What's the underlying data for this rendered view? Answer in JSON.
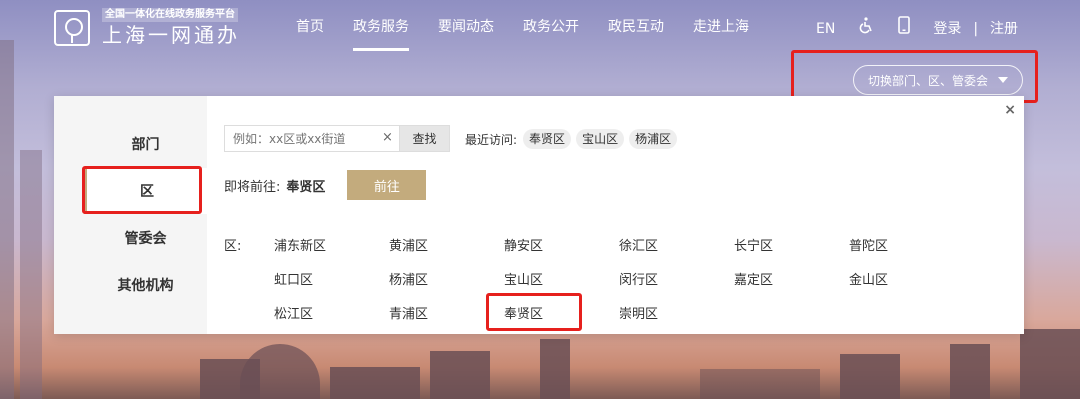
{
  "header": {
    "logo_sub": "全国一体化在线政务服务平台",
    "logo_main": "上海一网通办",
    "nav": [
      "首页",
      "政务服务",
      "要闻动态",
      "政务公开",
      "政民互动",
      "走进上海"
    ],
    "nav_active_index": 1,
    "lang": "EN",
    "accessibility_icon": "wheelchair-icon",
    "mobile_icon": "mobile-phone-icon",
    "login": "登录",
    "separator": "|",
    "register": "注册"
  },
  "switcher": {
    "label": "切换部门、区、管委会"
  },
  "panel": {
    "tabs": [
      "部门",
      "区",
      "管委会",
      "其他机构"
    ],
    "active_tab_index": 1,
    "close_symbol": "×",
    "search": {
      "placeholder": "例如：xx区或xx街道",
      "clear_symbol": "×",
      "button": "查找"
    },
    "recent": {
      "label": "最近访问:",
      "items": [
        "奉贤区",
        "宝山区",
        "杨浦区"
      ]
    },
    "goto": {
      "label": "即将前往:",
      "value": "奉贤区",
      "button": "前往"
    },
    "districts": {
      "label": "区:",
      "items": [
        "浦东新区",
        "黄浦区",
        "静安区",
        "徐汇区",
        "长宁区",
        "普陀区",
        "虹口区",
        "杨浦区",
        "宝山区",
        "闵行区",
        "嘉定区",
        "金山区",
        "松江区",
        "青浦区",
        "奉贤区",
        "崇明区"
      ],
      "highlighted": "奉贤区"
    }
  },
  "colors": {
    "accent": "#c3ab7d",
    "highlight_red": "#e6201d"
  }
}
